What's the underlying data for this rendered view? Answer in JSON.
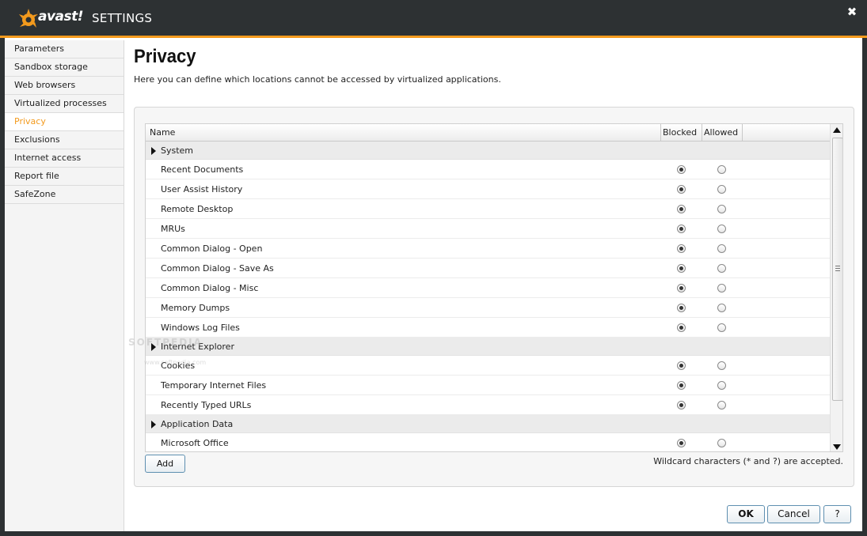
{
  "header": {
    "brand": "avast!",
    "title": "SETTINGS",
    "close_glyph": "✖"
  },
  "sidebar": {
    "items": [
      {
        "label": "Parameters",
        "active": false
      },
      {
        "label": "Sandbox storage",
        "active": false
      },
      {
        "label": "Web browsers",
        "active": false
      },
      {
        "label": "Virtualized processes",
        "active": false
      },
      {
        "label": "Privacy",
        "active": true
      },
      {
        "label": "Exclusions",
        "active": false
      },
      {
        "label": "Internet access",
        "active": false
      },
      {
        "label": "Report file",
        "active": false
      },
      {
        "label": "SafeZone",
        "active": false
      }
    ]
  },
  "main": {
    "title": "Privacy",
    "description": "Here you can define which locations cannot be accessed by virtualized applications."
  },
  "table": {
    "columns": {
      "name": "Name",
      "blocked": "Blocked",
      "allowed": "Allowed"
    },
    "groups": [
      {
        "label": "System",
        "items": [
          {
            "name": "Recent Documents",
            "value": "blocked"
          },
          {
            "name": "User Assist History",
            "value": "blocked"
          },
          {
            "name": "Remote Desktop",
            "value": "blocked"
          },
          {
            "name": "MRUs",
            "value": "blocked"
          },
          {
            "name": "Common Dialog - Open",
            "value": "blocked"
          },
          {
            "name": "Common Dialog - Save As",
            "value": "blocked"
          },
          {
            "name": "Common Dialog - Misc",
            "value": "blocked"
          },
          {
            "name": "Memory Dumps",
            "value": "blocked"
          },
          {
            "name": "Windows Log Files",
            "value": "blocked"
          }
        ]
      },
      {
        "label": "Internet Explorer",
        "items": [
          {
            "name": "Cookies",
            "value": "blocked"
          },
          {
            "name": "Temporary Internet Files",
            "value": "blocked"
          },
          {
            "name": "Recently Typed URLs",
            "value": "blocked"
          }
        ]
      },
      {
        "label": "Application Data",
        "items": [
          {
            "name": "Microsoft Office",
            "value": "blocked"
          }
        ]
      }
    ]
  },
  "actions": {
    "add_label": "Add",
    "wildcard_note": "Wildcard characters (* and ?) are accepted."
  },
  "footer": {
    "ok_label": "OK",
    "cancel_label": "Cancel",
    "help_label": "?"
  },
  "watermark": {
    "text": "SOFTPEDIA",
    "sub": "www.softpedia.com"
  },
  "colors": {
    "accent": "#f39a1d",
    "titlebar": "#2d3133"
  }
}
